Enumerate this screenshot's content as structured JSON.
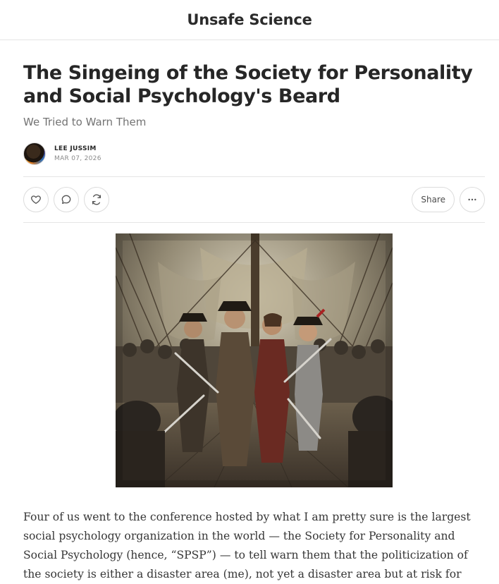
{
  "header": {
    "publication_name": "Unsafe Science"
  },
  "post": {
    "title": "The Singeing of the Society for Personality and Social Psychology's Beard",
    "subtitle": "We Tried to Warn Them",
    "author": "LEE JUSSIM",
    "date": "MAR 07, 2026"
  },
  "actions": {
    "like_icon": "heart-icon",
    "comment_icon": "comment-icon",
    "restack_icon": "restack-icon",
    "share_label": "Share",
    "more_icon": "more-icon"
  },
  "hero_image": {
    "subject": "pirate-battle-illustration"
  },
  "body": {
    "paragraph_1": "Four of us went to the conference hosted by what I am pretty sure is the largest social psychology organization in the world — the Society for Personality and Social Psychology (hence, “SPSP”) — to tell warn them that the politicization of the society is either a disaster area (me), not yet a disaster area but at risk for becoming one (Luke,"
  },
  "colors": {
    "text_primary": "#262626",
    "text_secondary": "#737373",
    "border": "#e5e5e5"
  }
}
